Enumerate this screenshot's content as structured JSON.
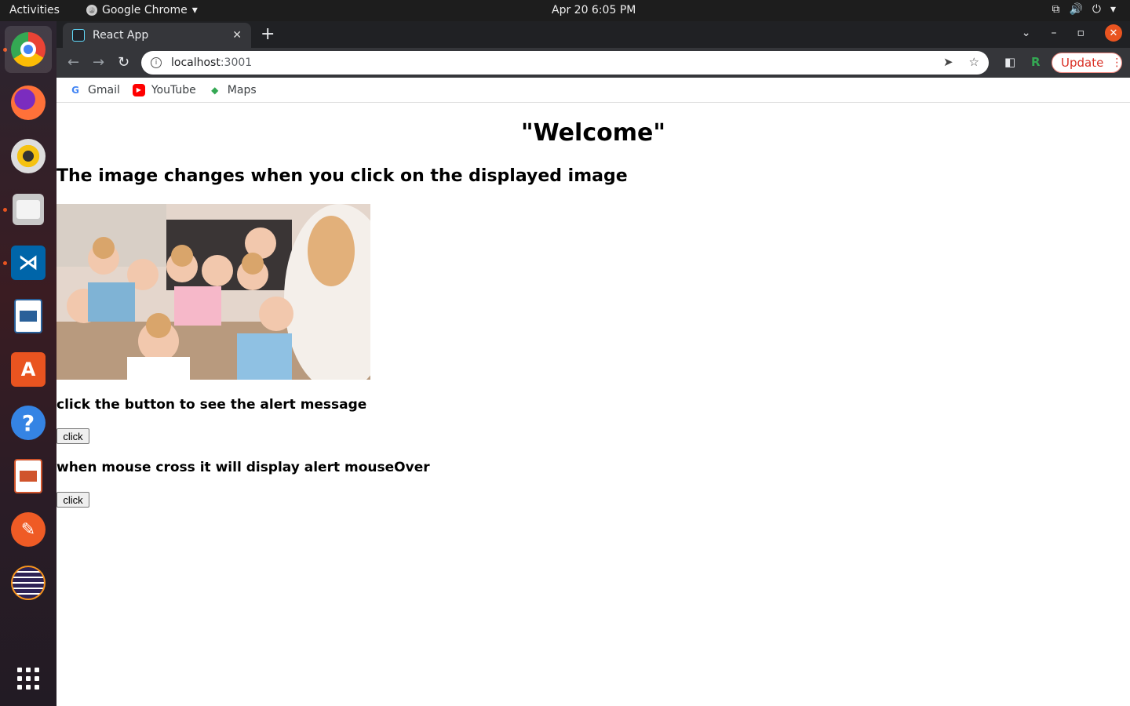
{
  "system": {
    "activities": "Activities",
    "app_menu": "Google Chrome",
    "clock": "Apr 20  6:05 PM"
  },
  "dock": {
    "items": [
      "chrome-icon",
      "firefox-icon",
      "rhythmbox-icon",
      "files-icon",
      "vscode-icon",
      "writer-icon",
      "app-center-icon",
      "help-icon",
      "impress-icon",
      "postman-icon",
      "eclipse-icon"
    ],
    "show_apps": "show-applications-icon"
  },
  "browser": {
    "tab_title": "React App",
    "url_host": "localhost",
    "url_port": ":3001",
    "update_label": "Update",
    "bookmarks": [
      "Gmail",
      "YouTube",
      "Maps"
    ]
  },
  "page": {
    "heading": "\"Welcome\"",
    "subheading": "The image changes when you click on the displayed image",
    "alert_prompt": "click the button to see the alert message",
    "alert_button": "click",
    "mouseover_prompt": "when mouse cross it will display alert mouseOver",
    "mouseover_button": "click"
  },
  "colors": {
    "accent": "#e95420",
    "tabstrip": "#202124",
    "toolbar": "#35363a"
  }
}
